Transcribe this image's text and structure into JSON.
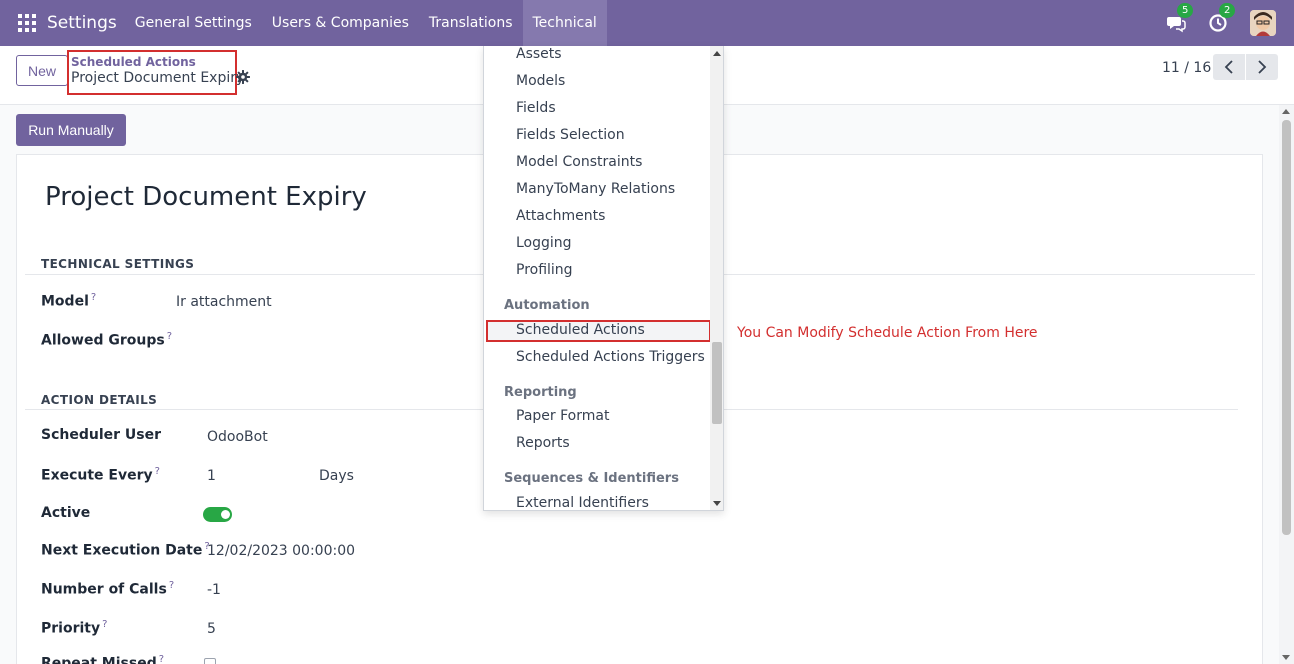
{
  "navbar": {
    "brand": "Settings",
    "menu": [
      "General Settings",
      "Users & Companies",
      "Translations",
      "Technical"
    ],
    "active_menu": "Technical",
    "messages_badge": "5",
    "activities_badge": "2",
    "accent_color": "#71639e"
  },
  "control_panel": {
    "new_button": "New",
    "breadcrumb_parent": "Scheduled Actions",
    "breadcrumb_current": "Project Document Expiry",
    "pager": "11 / 16"
  },
  "actions": {
    "run_manually": "Run Manually"
  },
  "record": {
    "title": "Project Document Expiry",
    "technical_settings": {
      "heading": "TECHNICAL SETTINGS",
      "model_label": "Model",
      "model_value": "Ir attachment",
      "groups_label": "Allowed Groups",
      "help_mark": "?"
    },
    "action_details": {
      "heading": "ACTION DETAILS",
      "scheduler_user_label": "Scheduler User",
      "scheduler_user_value": "OdooBot",
      "execute_every_label": "Execute Every",
      "execute_every_value": "1",
      "execute_every_unit": "Days",
      "active_label": "Active",
      "active_value": true,
      "next_exec_label": "Next Execution Date",
      "next_exec_value": "12/02/2023 00:00:00",
      "num_calls_label": "Number of Calls",
      "num_calls_value": "-1",
      "priority_label": "Priority",
      "priority_value": "5",
      "repeat_missed_label": "Repeat Missed"
    }
  },
  "dropdown": {
    "items_top": [
      "Assets",
      "Models",
      "Fields",
      "Fields Selection",
      "Model Constraints",
      "ManyToMany Relations",
      "Attachments",
      "Logging",
      "Profiling"
    ],
    "automation_header": "Automation",
    "automation_items": [
      "Scheduled Actions",
      "Scheduled Actions Triggers"
    ],
    "reporting_header": "Reporting",
    "reporting_items": [
      "Paper Format",
      "Reports"
    ],
    "sequences_header": "Sequences & Identifiers",
    "sequences_items": [
      "External Identifiers"
    ]
  },
  "annotation": "You Can Modify Schedule Action From Here"
}
